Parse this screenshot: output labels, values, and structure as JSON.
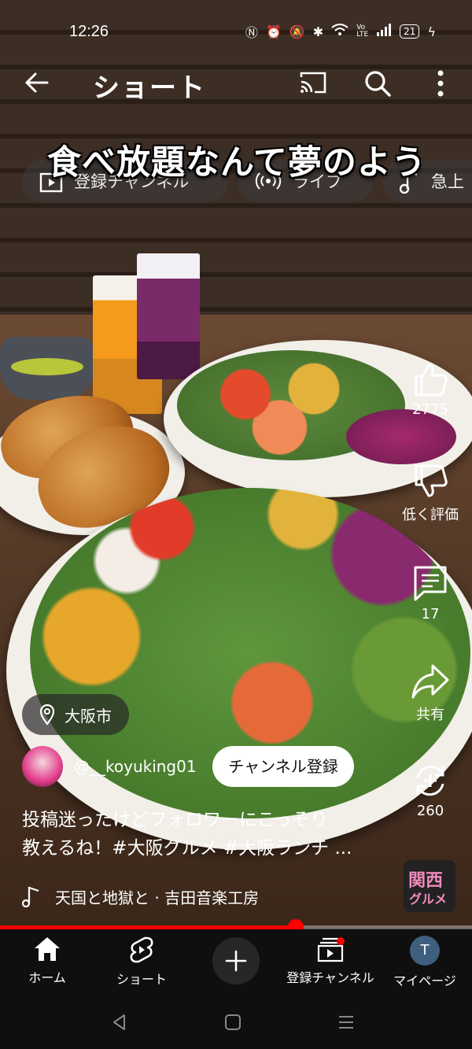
{
  "status_bar": {
    "time": "12:26",
    "battery": "21"
  },
  "header": {
    "title": "ショート"
  },
  "chips": [
    {
      "label": "登録チャンネル",
      "icon": "subscriptions-icon"
    },
    {
      "label": "ライブ",
      "icon": "live-icon"
    },
    {
      "label": "急上",
      "icon": "music-note-icon"
    }
  ],
  "video": {
    "overlay_text": "食べ放題なんて夢のよう"
  },
  "actions": {
    "like_count": "2775",
    "dislike_label": "低く評価",
    "comment_count": "17",
    "share_label": "共有",
    "remix_count": "260"
  },
  "location": {
    "label": "大阪市"
  },
  "channel": {
    "handle": "@__koyuking01",
    "subscribe_label": "チャンネル登録"
  },
  "caption": {
    "line1": "投稿迷ったけどフォロワーにこっそり",
    "line2": "教えるね！#大阪グルメ #大阪ランチ ..."
  },
  "music": {
    "label": "天国と地獄と · 吉田音楽工房"
  },
  "brand_badge": {
    "line1": "関西",
    "line2": "グルメ"
  },
  "progress": {
    "fraction": 0.627
  },
  "bottom_nav": [
    {
      "label": "ホーム",
      "icon": "home-icon"
    },
    {
      "label": "ショート",
      "icon": "shorts-icon"
    },
    {
      "label": "",
      "icon": "create-icon"
    },
    {
      "label": "登録チャンネル",
      "icon": "subscriptions-icon"
    },
    {
      "label": "マイページ",
      "icon": "avatar",
      "avatar_letter": "T"
    }
  ],
  "colors": {
    "accent": "#ff0000",
    "nav_bg": "#0f0f0f"
  }
}
